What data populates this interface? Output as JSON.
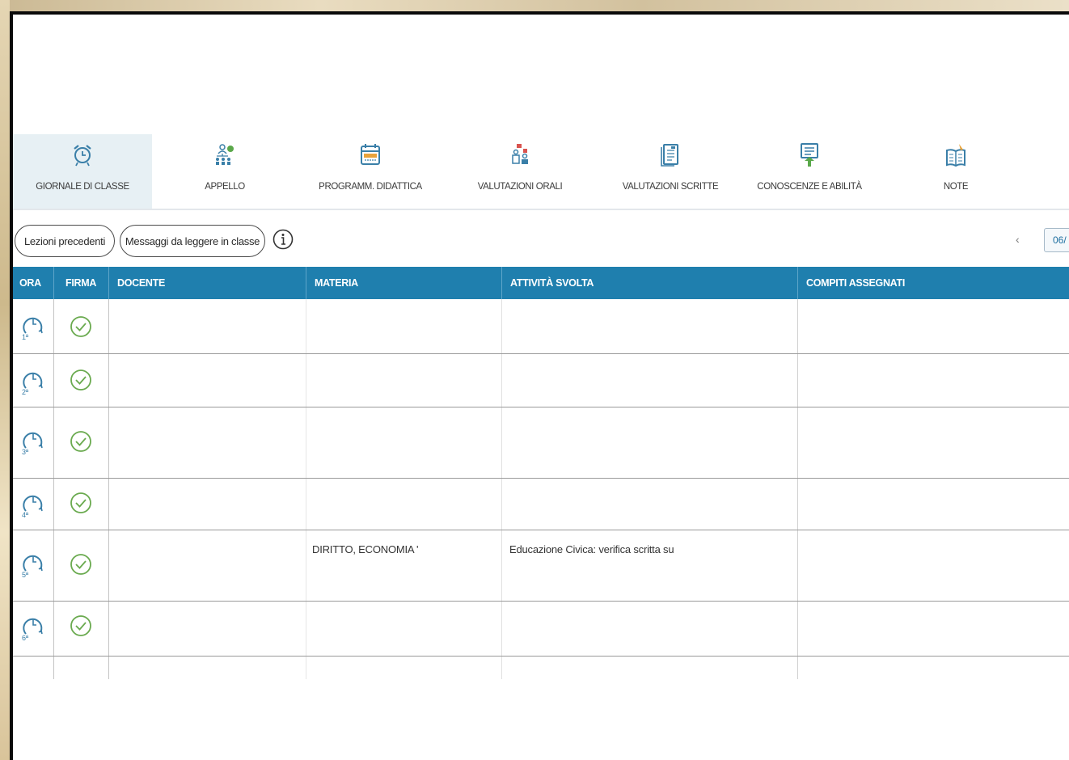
{
  "toolbar": {
    "items": [
      {
        "label": "GIORNALE DI CLASSE",
        "icon": "alarm-clock-icon",
        "active": true
      },
      {
        "label": "APPELLO",
        "icon": "students-roll-call-icon",
        "active": false
      },
      {
        "label": "PROGRAMM. DIDATTICA",
        "icon": "calendar-icon",
        "active": false
      },
      {
        "label": "VALUTAZIONI ORALI",
        "icon": "oral-grades-icon",
        "active": false
      },
      {
        "label": "VALUTAZIONI SCRITTE",
        "icon": "written-grades-icon",
        "active": false
      },
      {
        "label": "CONOSCENZE E ABILITÀ",
        "icon": "skills-icon",
        "active": false
      },
      {
        "label": "NOTE",
        "icon": "notes-book-icon",
        "active": false
      }
    ]
  },
  "actions": {
    "previous_lessons": "Lezioni precedenti",
    "messages": "Messaggi da leggere in classe",
    "info_icon": "info-icon",
    "prev_arrow": "‹",
    "date": "06/"
  },
  "table": {
    "headers": {
      "ora": "ORA",
      "firma": "FIRMA",
      "docente": "DOCENTE",
      "materia": "MATERIA",
      "attivita": "ATTIVITÀ SVOLTA",
      "compiti": "COMPITI ASSEGNATI"
    },
    "rows": [
      {
        "ora": "1ª",
        "signed": true,
        "docente": "",
        "materia": "",
        "attivita": "",
        "compiti": ""
      },
      {
        "ora": "2ª",
        "signed": true,
        "docente": "",
        "materia": "",
        "attivita": "",
        "compiti": ""
      },
      {
        "ora": "3ª",
        "signed": true,
        "docente": "",
        "materia": "",
        "attivita": "",
        "compiti": ""
      },
      {
        "ora": "4ª",
        "signed": true,
        "docente": "",
        "materia": "",
        "attivita": "",
        "compiti": ""
      },
      {
        "ora": "5ª",
        "signed": true,
        "docente": "",
        "materia": "DIRITTO, ECONOMIA '",
        "attivita": "Educazione Civica: verifica scritta su",
        "compiti": ""
      },
      {
        "ora": "6ª",
        "signed": true,
        "docente": "",
        "materia": "",
        "attivita": "",
        "compiti": ""
      }
    ]
  },
  "colors": {
    "header_blue": "#1f7fae",
    "active_tab_bg": "#e7f0f4",
    "check_green": "#6aaa4f",
    "icon_blue": "#3a7fa8"
  }
}
